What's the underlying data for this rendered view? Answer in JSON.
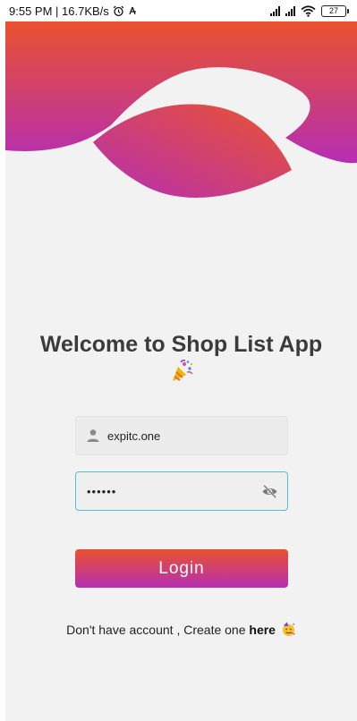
{
  "status_bar": {
    "time_speed": "9:55 PM | 16.7KB/s",
    "battery": "27"
  },
  "colors": {
    "gradient_top": "#e9522e",
    "gradient_bottom": "#b62eb3",
    "focus_border": "#4fc3d6",
    "background": "#f2f2f2"
  },
  "welcome": {
    "title": "Welcome to Shop List App",
    "emoji": "party-popper-icon"
  },
  "login_form": {
    "email_value": "expitc.one",
    "password_value": "••••••",
    "login_label": "Login"
  },
  "signup": {
    "prompt": "Don't have account , Create one",
    "link_label": "here",
    "emoji": "party-face-icon"
  }
}
